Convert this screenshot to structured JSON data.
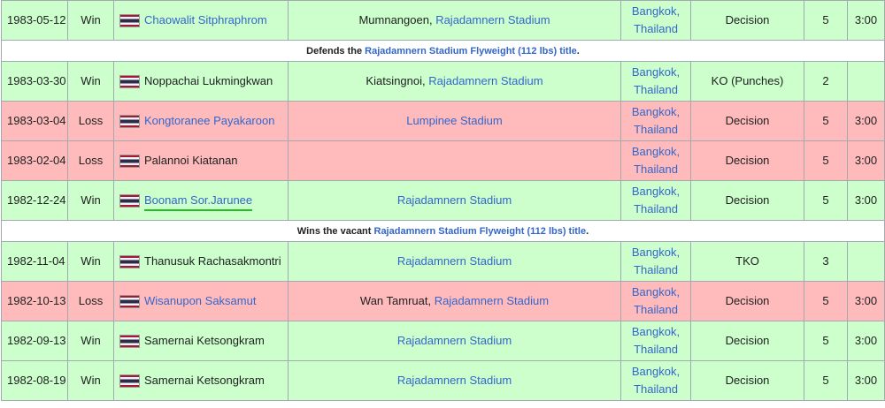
{
  "rows": [
    {
      "type": "fight",
      "result_class": "win",
      "date": "1983-05-12",
      "result": "Win",
      "opponent": "Chaowalit Sitphraphrom",
      "opponent_link": true,
      "event_prefix": "Mumnangoen, ",
      "event": "Rajadamnern Stadium",
      "city": "Bangkok,",
      "country": "Thailand",
      "method": "Decision",
      "round": "5",
      "time": "3:00"
    },
    {
      "type": "note",
      "prefix": "Defends the ",
      "link": "Rajadamnern Stadium Flyweight (112 lbs) title",
      "suffix": "."
    },
    {
      "type": "fight",
      "result_class": "win",
      "date": "1983-03-30",
      "result": "Win",
      "opponent": "Noppachai Lukmingkwan",
      "opponent_link": false,
      "event_prefix": "Kiatsingnoi, ",
      "event": "Rajadamnern Stadium",
      "city": "Bangkok,",
      "country": "Thailand",
      "method": "KO (Punches)",
      "round": "2",
      "time": ""
    },
    {
      "type": "fight",
      "result_class": "loss",
      "date": "1983-03-04",
      "result": "Loss",
      "opponent": "Kongtoranee Payakaroon",
      "opponent_link": true,
      "event_prefix": "",
      "event": "Lumpinee Stadium",
      "city": "Bangkok,",
      "country": "Thailand",
      "method": "Decision",
      "round": "5",
      "time": "3:00"
    },
    {
      "type": "fight",
      "result_class": "loss",
      "date": "1983-02-04",
      "result": "Loss",
      "opponent": "Palannoi Kiatanan",
      "opponent_link": false,
      "event_prefix": "",
      "event": "",
      "city": "Bangkok,",
      "country": "Thailand",
      "method": "Decision",
      "round": "5",
      "time": "3:00"
    },
    {
      "type": "fight",
      "result_class": "win",
      "date": "1982-12-24",
      "result": "Win",
      "opponent": "Boonam Sor.Jarunee",
      "opponent_link": true,
      "opponent_underlined": true,
      "event_prefix": "",
      "event": "Rajadamnern Stadium",
      "city": "Bangkok,",
      "country": "Thailand",
      "method": "Decision",
      "round": "5",
      "time": "3:00"
    },
    {
      "type": "note",
      "prefix": "Wins the vacant ",
      "link": "Rajadamnern Stadium Flyweight (112 lbs) title",
      "suffix": "."
    },
    {
      "type": "fight",
      "result_class": "win",
      "date": "1982-11-04",
      "result": "Win",
      "opponent": "Thanusuk Rachasakmontri",
      "opponent_link": false,
      "event_prefix": "",
      "event": "Rajadamnern Stadium",
      "city": "Bangkok,",
      "country": "Thailand",
      "method": "TKO",
      "round": "3",
      "time": ""
    },
    {
      "type": "fight",
      "result_class": "loss",
      "date": "1982-10-13",
      "result": "Loss",
      "opponent": "Wisanupon Saksamut",
      "opponent_link": true,
      "event_prefix": "Wan Tamruat, ",
      "event": "Rajadamnern Stadium",
      "city": "Bangkok,",
      "country": "Thailand",
      "method": "Decision",
      "round": "5",
      "time": "3:00"
    },
    {
      "type": "fight",
      "result_class": "win",
      "date": "1982-09-13",
      "result": "Win",
      "opponent": "Samernai Ketsongkram",
      "opponent_link": false,
      "event_prefix": "",
      "event": "Rajadamnern Stadium",
      "city": "Bangkok,",
      "country": "Thailand",
      "method": "Decision",
      "round": "5",
      "time": "3:00"
    },
    {
      "type": "fight",
      "result_class": "win",
      "date": "1982-08-19",
      "result": "Win",
      "opponent": "Samernai Ketsongkram",
      "opponent_link": false,
      "event_prefix": "",
      "event": "Rajadamnern Stadium",
      "city": "Bangkok,",
      "country": "Thailand",
      "method": "Decision",
      "round": "5",
      "time": "3:00"
    }
  ],
  "colors": {
    "win": "#ccffcc",
    "loss": "#ffbbbb",
    "link": "#3366cc",
    "underline": "#22c022"
  },
  "flag_icon": "thailand-flag-icon"
}
